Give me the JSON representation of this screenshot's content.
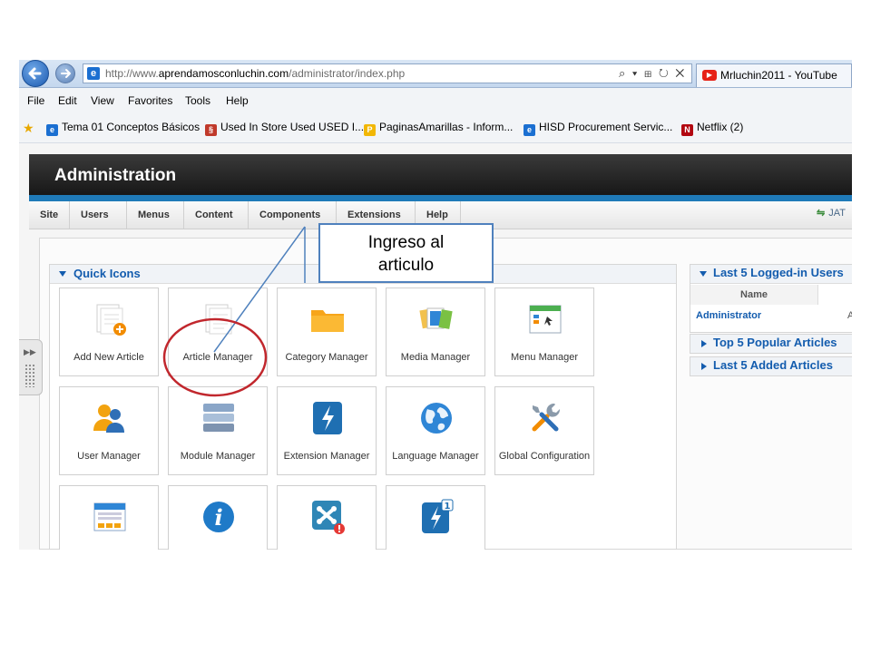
{
  "browser": {
    "url_prefix": "http://www.",
    "url_domain": "aprendamosconluchin.com",
    "url_path": "/administrator/index.php",
    "tab_title": "Mrluchin2011 - YouTube",
    "url_tool_glyphs": "⌕ ▾ ⊞ ↻ ✕"
  },
  "menubar": [
    "File",
    "Edit",
    "View",
    "Favorites",
    "Tools",
    "Help"
  ],
  "favorites": [
    {
      "label": "Tema 01 Conceptos Básicos",
      "color": "#1b6fd1",
      "glyph": "e"
    },
    {
      "label": "Used In Store Used USED I...",
      "color": "#c0392b",
      "glyph": "§"
    },
    {
      "label": "PaginasAmarillas - Inform...",
      "color": "#f2b705",
      "glyph": "P"
    },
    {
      "label": "HISD  Procurement Servic...",
      "color": "#1b6fd1",
      "glyph": "e"
    },
    {
      "label": "Netflix (2)",
      "color": "#b20710",
      "glyph": "N"
    }
  ],
  "admin": {
    "title": "Administration",
    "menu": [
      "Site",
      "Users",
      "Menus",
      "Content",
      "Components",
      "Extensions",
      "Help"
    ],
    "jat_text": "JAT"
  },
  "quick_icons": {
    "title": "Quick Icons",
    "row1": [
      "Add New Article",
      "Article Manager",
      "Category Manager",
      "Media Manager",
      "Menu Manager"
    ],
    "row2": [
      "User Manager",
      "Module Manager",
      "Extension Manager",
      "Language Manager",
      "Global Configuration"
    ]
  },
  "right_panels": {
    "logged_in": {
      "title": "Last 5 Logged-in Users",
      "col_name": "Name",
      "row_user": "Administrator",
      "row_extra": "A"
    },
    "popular": {
      "title": "Top 5 Popular Articles"
    },
    "added": {
      "title": "Last 5 Added Articles"
    }
  },
  "annotation": {
    "line1": "Ingreso al",
    "line2": "articulo"
  },
  "colors": {
    "accent_blue": "#135cae",
    "header_dark": "#1e1e1e",
    "strip_blue": "#1f7ab8",
    "annotation_red": "#c1272d",
    "callout_border": "#4f81bd"
  }
}
